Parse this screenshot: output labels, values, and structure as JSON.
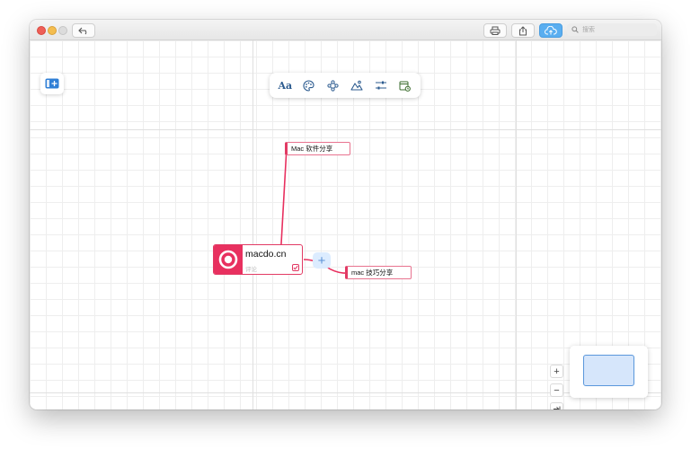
{
  "titlebar": {
    "traffic_lights": [
      "close-red",
      "minimize-yellow",
      "zoom-inactive"
    ],
    "undo_icon": "undo-arrow-icon",
    "print_icon": "printer-icon",
    "share_icon": "share-icon",
    "cloud_icon": "cloud-upload-icon",
    "search_placeholder": "搜索"
  },
  "toolbar": {
    "font_label": "Aa",
    "items": [
      "font-icon",
      "palette-icon",
      "nodes-icon",
      "image-icon",
      "adjust-icon",
      "calendar-icon"
    ]
  },
  "mindmap": {
    "root": {
      "title": "macdo.cn",
      "note": "评论"
    },
    "add_label": "+",
    "children": [
      {
        "label": "Mac 软件分享"
      },
      {
        "label": "mac 技巧分享"
      }
    ]
  },
  "zoom": {
    "in": "+",
    "out": "−",
    "fit_icon": "fit-arrow-icon"
  },
  "colors": {
    "accent": "#e8305f",
    "button_blue": "#5aaef0",
    "minimap": "#d6e6fb"
  }
}
